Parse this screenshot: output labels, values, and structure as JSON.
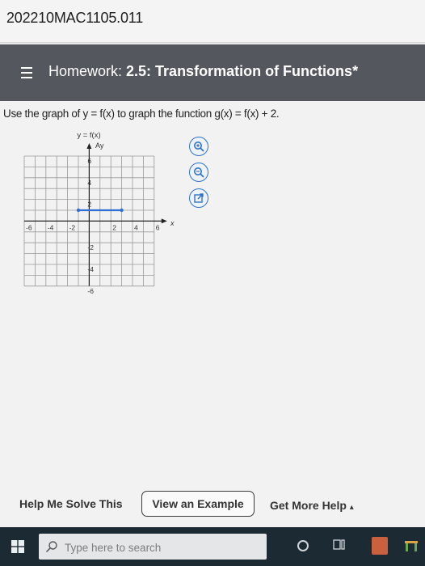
{
  "course": {
    "id": "202210MAC1105.011"
  },
  "header": {
    "prefix": "Homework: ",
    "title": "2.5: Transformation of Functions",
    "suffix": "*"
  },
  "question": {
    "text": "Use the graph of y = f(x) to graph the function g(x) = f(x) + 2."
  },
  "graph": {
    "function_label": "y = f(x)",
    "y_axis_label": "Ay",
    "x_axis_label": "x",
    "x_tick_labels": [
      "-6",
      "-4",
      "-2",
      "2",
      "4",
      "6"
    ],
    "y_tick_labels": [
      "6",
      "4",
      "2",
      "-2",
      "-4",
      "-6"
    ]
  },
  "chart_data": {
    "type": "line",
    "series": [
      {
        "x": [
          -1,
          3
        ],
        "y": [
          1,
          1
        ]
      }
    ],
    "xlim": [
      -6,
      6
    ],
    "ylim": [
      -6,
      6
    ],
    "grid": true,
    "line_color": "#2f6fd6"
  },
  "tools": [
    {
      "icon": "zoom-in-icon"
    },
    {
      "icon": "zoom-out-icon"
    },
    {
      "icon": "open-new-window-icon"
    }
  ],
  "help": {
    "solve_label": "Help Me Solve This",
    "example_label": "View an Example",
    "more_label": "Get More Help",
    "more_arrow": "▴"
  },
  "taskbar": {
    "search_placeholder": "Type here to search"
  },
  "colors": {
    "header_bg": "#55575e",
    "accent": "#2f73c4",
    "taskbar_bg": "#1c2a33"
  }
}
